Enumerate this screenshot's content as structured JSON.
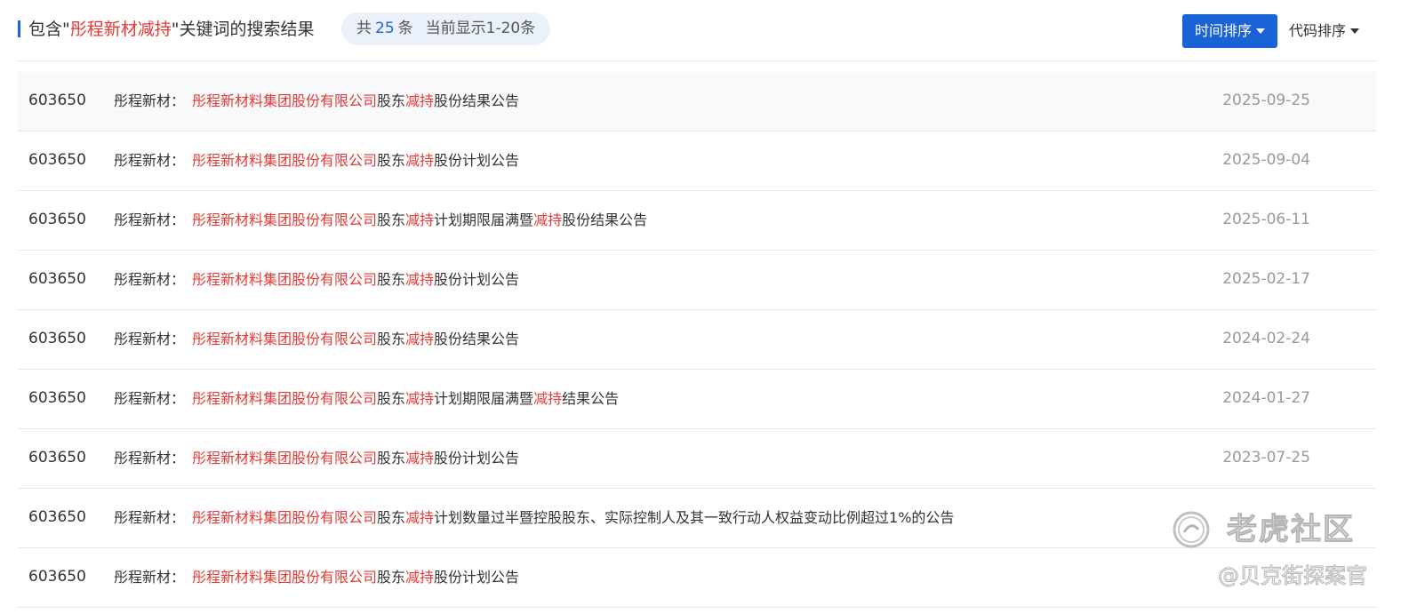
{
  "header": {
    "title_prefix": "包含\"",
    "keyword": "彤程新材减持",
    "title_suffix": "\"关键词的搜索结果",
    "count_prefix": "共",
    "count": "25",
    "count_suffix": "条",
    "range_text": "当前显示1-20条",
    "sort_time_label": "时间排序",
    "sort_code_label": "代码排序"
  },
  "colors": {
    "accent": "#1a63d6",
    "highlight": "#e53935",
    "date": "#999999"
  },
  "results": [
    {
      "code": "603650",
      "stock": "彤程新材：",
      "company": "彤程新材料集团股份有限公司",
      "t1": "股东",
      "kw1": "减持",
      "t2": "股份结果公告",
      "kw2": "",
      "t3": "",
      "date": "2025-09-25"
    },
    {
      "code": "603650",
      "stock": "彤程新材：",
      "company": "彤程新材料集团股份有限公司",
      "t1": "股东",
      "kw1": "减持",
      "t2": "股份计划公告",
      "kw2": "",
      "t3": "",
      "date": "2025-09-04"
    },
    {
      "code": "603650",
      "stock": "彤程新材：",
      "company": "彤程新材料集团股份有限公司",
      "t1": "股东",
      "kw1": "减持",
      "t2": "计划期限届满暨",
      "kw2": "减持",
      "t3": "股份结果公告",
      "date": "2025-06-11"
    },
    {
      "code": "603650",
      "stock": "彤程新材：",
      "company": "彤程新材料集团股份有限公司",
      "t1": "股东",
      "kw1": "减持",
      "t2": "股份计划公告",
      "kw2": "",
      "t3": "",
      "date": "2025-02-17"
    },
    {
      "code": "603650",
      "stock": "彤程新材：",
      "company": "彤程新材料集团股份有限公司",
      "t1": "股东",
      "kw1": "减持",
      "t2": "股份结果公告",
      "kw2": "",
      "t3": "",
      "date": "2024-02-24"
    },
    {
      "code": "603650",
      "stock": "彤程新材：",
      "company": "彤程新材料集团股份有限公司",
      "t1": "股东",
      "kw1": "减持",
      "t2": "计划期限届满暨",
      "kw2": "减持",
      "t3": "结果公告",
      "date": "2024-01-27"
    },
    {
      "code": "603650",
      "stock": "彤程新材：",
      "company": "彤程新材料集团股份有限公司",
      "t1": "股东",
      "kw1": "减持",
      "t2": "股份计划公告",
      "kw2": "",
      "t3": "",
      "date": "2023-07-25"
    },
    {
      "code": "603650",
      "stock": "彤程新材：",
      "company": "彤程新材料集团股份有限公司",
      "t1": "股东",
      "kw1": "减持",
      "t2": "计划数量过半暨控股股东、实际控制人及其一致行动人权益变动比例超过1%的公告",
      "kw2": "",
      "t3": "",
      "date": ""
    },
    {
      "code": "603650",
      "stock": "彤程新材：",
      "company": "彤程新材料集团股份有限公司",
      "t1": "股东",
      "kw1": "减持",
      "t2": "股份计划公告",
      "kw2": "",
      "t3": "",
      "date": ""
    }
  ],
  "watermark": {
    "title": "老虎社区",
    "author": "@贝克街探案官"
  }
}
